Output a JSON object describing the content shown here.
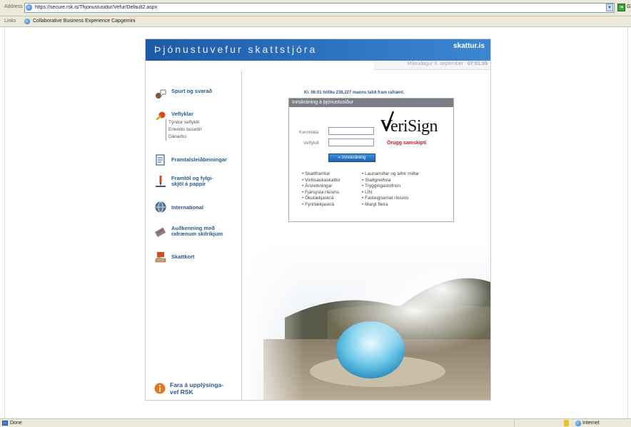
{
  "browser": {
    "address_label": "Address",
    "url": "https://secure.rsk.is/Thjonustusidur/Vefur/Default2.aspx",
    "go_label": "G",
    "links_label": "Links",
    "links": [
      "Collaborative Business Experience  Capgemini"
    ],
    "status_text": "Done",
    "zone_text": "Internet"
  },
  "header": {
    "title": "Þjónustuvefur skattstjóra",
    "brand": "skattur.is",
    "date": "Mánudagur 3. september",
    "time": "07:01:05"
  },
  "nav": {
    "items": [
      {
        "label": "Spurt og svarað",
        "icon": "question-icon"
      },
      {
        "label": "Veflyklar",
        "icon": "key-icon",
        "sub": [
          "Týndur veflykill",
          "Erlendis búsettir",
          "Dánarbú"
        ]
      },
      {
        "label": "Framtalsleiðbeiningar",
        "icon": "document-icon"
      },
      {
        "label": "Framtöl og fylgi-\nskjöl á pappír",
        "icon": "pen-icon"
      },
      {
        "label": "International",
        "icon": "globe-icon"
      },
      {
        "label": "Auðkenning með\nrafrænum skilríkjum",
        "icon": "card-icon"
      },
      {
        "label": "Skattkort",
        "icon": "hand-card-icon"
      }
    ],
    "rsk_link": "Fara á upplýsinga-\nvef RSK"
  },
  "login": {
    "notice": "Kl. 06:01 höfðu 238.227 manns talið fram rafrænt.",
    "heading": "Innskráning á þjónustusíður",
    "kennitala_label": "Kennitala",
    "kennitala_value": "",
    "veflykill_label": "Veflykill",
    "veflykill_value": "",
    "button": "Innskráning",
    "verisign": "VeriSign",
    "secure_text": "Örugg samskipti",
    "services_left": [
      "Skattframtal",
      "Virðisaukaskattur",
      "Ársreikningar",
      "Fjársýsla ríkisins",
      "Ökutækjaskrá",
      "Fyrirtækjaskrá"
    ],
    "services_right": [
      "Launamiðar og aðrir miðar",
      "Staðgreiðsla",
      "Tryggingastofnun",
      "LÍN",
      "Fasteignamat ríkisins",
      "Margt fleira"
    ]
  },
  "colors": {
    "banner": "#1d5aa5",
    "nav_text": "#2b5a8c",
    "secure_red": "#c0202a"
  }
}
